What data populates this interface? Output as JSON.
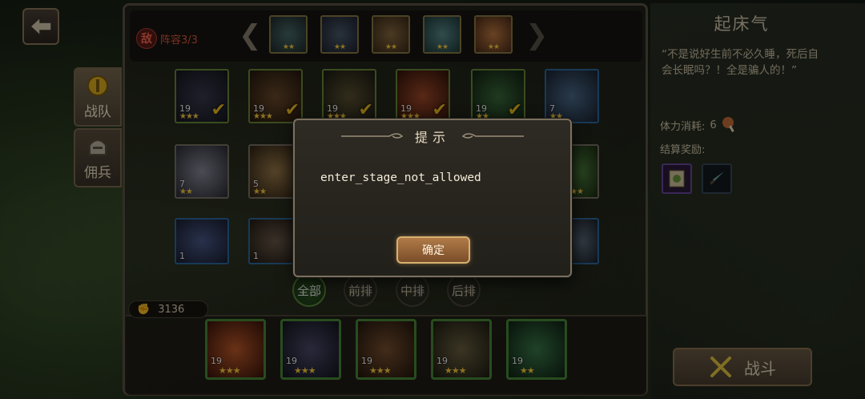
{
  "lineup": {
    "enemy_badge": "敌",
    "label": "阵容3/3"
  },
  "tabs": [
    {
      "label": "战队",
      "icon": "helmet-icon"
    },
    {
      "label": "佣兵",
      "icon": "knight-helmet-icon"
    }
  ],
  "enemy_slots": [
    {
      "stars": "★★"
    },
    {
      "stars": "★★"
    },
    {
      "stars": "★★"
    },
    {
      "stars": "★★"
    },
    {
      "stars": "★★"
    }
  ],
  "hero_grid": [
    {
      "level": "19",
      "stars": "★★★",
      "selected": true
    },
    {
      "level": "19",
      "stars": "★★★",
      "selected": true
    },
    {
      "level": "19",
      "stars": "★★★",
      "selected": true
    },
    {
      "level": "19",
      "stars": "★★★",
      "selected": true
    },
    {
      "level": "19",
      "stars": "★★",
      "selected": true
    },
    {
      "level": "7",
      "stars": "★★",
      "selected": false
    },
    {
      "level": "7",
      "stars": "★★",
      "selected": false
    },
    {
      "level": "5",
      "stars": "★★",
      "selected": false
    },
    {
      "level": "",
      "stars": "★★",
      "selected": false
    },
    {
      "level": "1",
      "stars": "",
      "selected": false
    },
    {
      "level": "1",
      "stars": "",
      "selected": false
    },
    {
      "level": "",
      "stars": "",
      "selected": false
    }
  ],
  "filters": [
    "全部",
    "前排",
    "中排",
    "后排"
  ],
  "power": {
    "value": "3136"
  },
  "team": [
    {
      "level": "19",
      "stars": "★★★"
    },
    {
      "level": "19",
      "stars": "★★★"
    },
    {
      "level": "19",
      "stars": "★★★"
    },
    {
      "level": "19",
      "stars": "★★★"
    },
    {
      "level": "19",
      "stars": "★★"
    }
  ],
  "stage": {
    "title": "起床气",
    "description": "“不是说好生前不必久睡，死后自会长眠吗？！全是骗人的！”",
    "stamina_label": "体力消耗:",
    "stamina_value": "6",
    "reward_label": "结算奖励:"
  },
  "battle_button": "战斗",
  "dialog": {
    "title": "提示",
    "message": "enter_stage_not_allowed",
    "ok": "确定"
  },
  "colors": {
    "accent_gold": "#f2c020",
    "enemy_red": "#e05a3a",
    "ok_button": "#b07a48"
  }
}
